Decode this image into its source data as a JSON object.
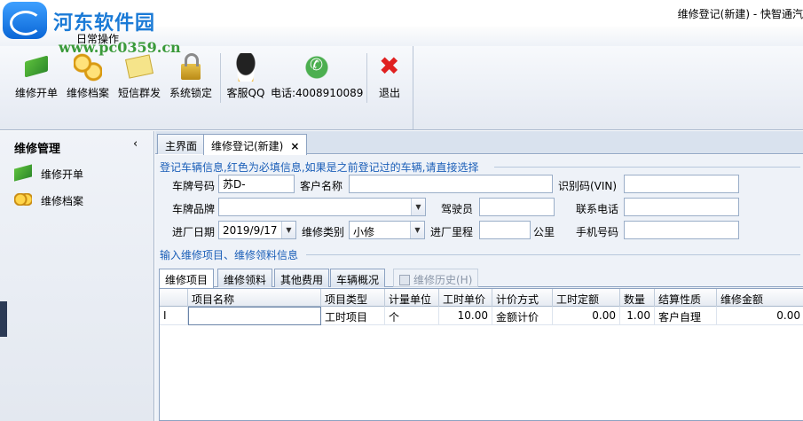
{
  "watermark": {
    "brand": "河东软件园",
    "url": "www.pc0359.cn"
  },
  "window": {
    "title": "维修登记(新建) - 快智通汽"
  },
  "ribbon": {
    "tab": "日常操作",
    "buttons": [
      {
        "label": "维修开单",
        "icon": "repair-order-icon"
      },
      {
        "label": "维修档案",
        "icon": "coins-icon"
      },
      {
        "label": "短信群发",
        "icon": "mail-icon"
      },
      {
        "label": "系统锁定",
        "icon": "lock-icon"
      },
      {
        "label": "客服QQ",
        "icon": "qq-icon"
      },
      {
        "label": "电话:4008910089",
        "icon": "phone-icon"
      },
      {
        "label": "退出",
        "icon": "exit-icon"
      }
    ]
  },
  "sidebar": {
    "title": "维修管理",
    "collapse": "‹",
    "items": [
      {
        "label": "维修开单"
      },
      {
        "label": "维修档案"
      }
    ]
  },
  "doc_tabs": [
    {
      "label": "主界面"
    },
    {
      "label": "维修登记(新建)",
      "close": "×"
    }
  ],
  "vehicle_group": {
    "caption": "登记车辆信息,红色为必填信息,如果是之前登记过的车辆,请直接选择",
    "plate_label": "车牌号码",
    "plate_value": "苏D-",
    "customer_label": "客户名称",
    "customer_value": "",
    "vin_label": "识别码(VIN)",
    "vin_value": "",
    "brand_label": "车牌品牌",
    "brand_value": "",
    "driver_label": "驾驶员",
    "driver_value": "",
    "phone_label": "联系电话",
    "phone_value": "",
    "date_label": "进厂日期",
    "date_value": "2019/9/17",
    "type_label": "维修类别",
    "type_value": "小修",
    "mileage_label": "进厂里程",
    "mileage_value": "",
    "mileage_unit": "公里",
    "mobile_label": "手机号码",
    "mobile_value": ""
  },
  "items_group": {
    "caption": "输入维修项目、维修领料信息",
    "tabs": [
      "维修项目",
      "维修领料",
      "其他费用",
      "车辆概况"
    ],
    "history_tab": "维修历史(H)"
  },
  "grid": {
    "columns": [
      "项目名称",
      "项目类型",
      "计量单位",
      "工时单价",
      "计价方式",
      "工时定额",
      "数量",
      "结算性质",
      "维修金额"
    ],
    "rows": [
      {
        "indicator": "I",
        "name": "",
        "type": "工时项目",
        "unit": "个",
        "price": "10.00",
        "method": "金额计价",
        "quota": "0.00",
        "qty": "1.00",
        "settle": "客户自理",
        "amount": "0.00"
      }
    ]
  }
}
